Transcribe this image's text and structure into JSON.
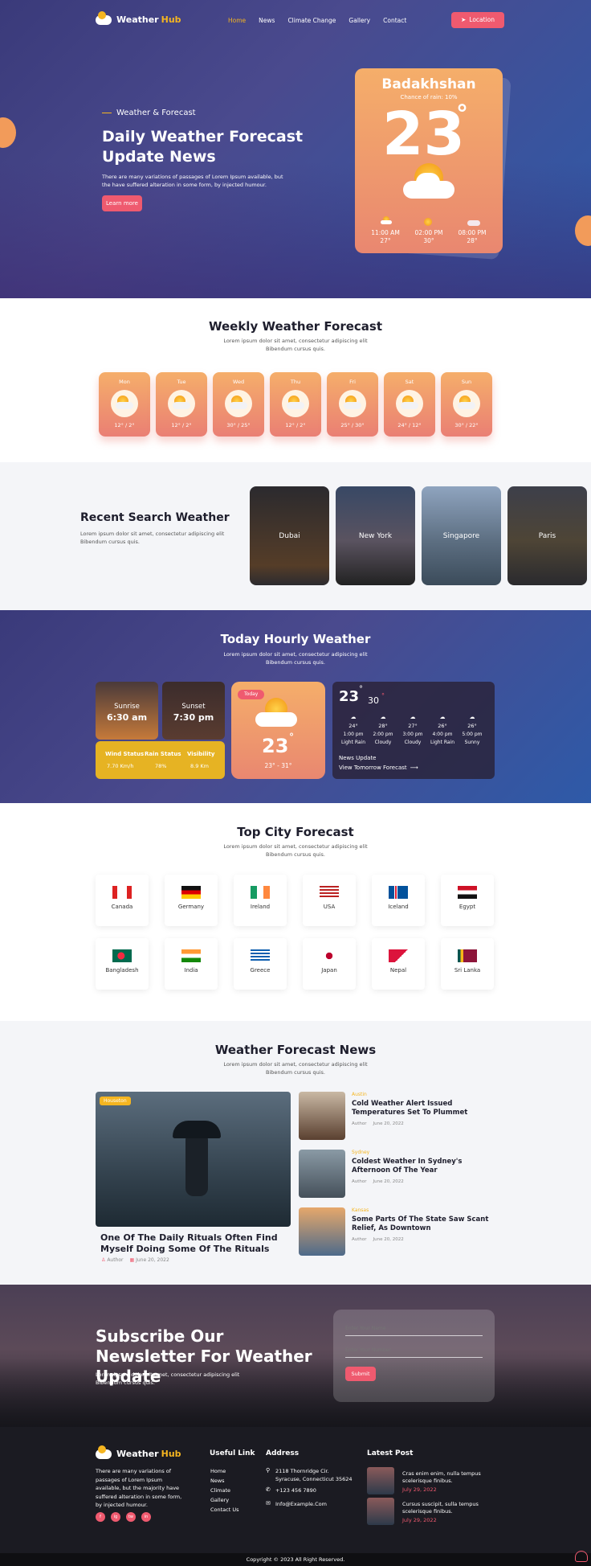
{
  "header": {
    "logo_main": "Weather",
    "logo_accent": "Hub",
    "nav": [
      "Home",
      "News",
      "Climate Change",
      "Gallery",
      "Contact"
    ],
    "location_btn": "Location"
  },
  "hero": {
    "eyebrow": "Weather & Forecast",
    "title": "Daily Weather Forecast Update News",
    "desc": "There are many variations of passages of Lorem Ipsum available, but the have suffered alteration in some form, by injected humour.",
    "cta": "Learn more",
    "card": {
      "city": "Badakhshan",
      "sub": "Chance of rain: 10%",
      "temp": "23",
      "deg": "°",
      "hours": [
        {
          "t": "11:00 AM",
          "v": "27°"
        },
        {
          "t": "02:00 PM",
          "v": "30°"
        },
        {
          "t": "08:00 PM",
          "v": "28°"
        }
      ]
    }
  },
  "weekly": {
    "title": "Weekly Weather Forecast",
    "sub": "Lorem ipsum dolor sit amet, consectetur adipiscing elit Bibendum cursus quis.",
    "days": [
      {
        "d": "Mon",
        "t": "12° / 2°"
      },
      {
        "d": "Tue",
        "t": "12° / 2°"
      },
      {
        "d": "Wed",
        "t": "30° / 25°"
      },
      {
        "d": "Thu",
        "t": "12° / 2°"
      },
      {
        "d": "Fri",
        "t": "25° / 30°"
      },
      {
        "d": "Sat",
        "t": "24° / 12°"
      },
      {
        "d": "Sun",
        "t": "30° / 22°"
      }
    ]
  },
  "recent": {
    "title": "Recent Search Weather",
    "sub": "Lorem ipsum dolor sit amet, consectetur adipiscing elit Bibendum cursus quis.",
    "cities": [
      "Dubai",
      "New York",
      "Singapore",
      "Paris"
    ]
  },
  "hourly": {
    "title": "Today Hourly Weather",
    "sub": "Lorem ipsum dolor sit amet, consectetur adipiscing elit Bibendum cursus quis.",
    "sunrise_label": "Sunrise",
    "sunrise": "6:30 am",
    "sunset_label": "Sunset",
    "sunset": "7:30 pm",
    "stats": [
      {
        "l": "Wind Status",
        "v": "7.70 Km/h"
      },
      {
        "l": "Rain Status",
        "v": "78%"
      },
      {
        "l": "Visibility",
        "v": "8.9 Km"
      }
    ],
    "today_badge": "Today",
    "today_temp": "23",
    "today_range": "23° - 31°",
    "big_temp": "23",
    "small_temp": "30",
    "slots": [
      {
        "deg": "24°",
        "time": "1:00 pm",
        "cond": "Light Rain"
      },
      {
        "deg": "28°",
        "time": "2:00 pm",
        "cond": "Cloudy"
      },
      {
        "deg": "27°",
        "time": "3:00 pm",
        "cond": "Cloudy"
      },
      {
        "deg": "26°",
        "time": "4:00 pm",
        "cond": "Light Rain"
      },
      {
        "deg": "26°",
        "time": "5:00 pm",
        "cond": "Sunny"
      }
    ],
    "news_update": "News Update",
    "tomorrow": "View Tomorrow Forecast"
  },
  "top": {
    "title": "Top City Forecast",
    "sub": "Lorem ipsum dolor sit amet, consectetur adipiscing elit Bibendum cursus quis.",
    "countries": [
      "Canada",
      "Germany",
      "Ireland",
      "USA",
      "Iceland",
      "Egypt",
      "Bangladesh",
      "India",
      "Greece",
      "Japan",
      "Nepal",
      "Sri Lanka"
    ]
  },
  "news": {
    "title": "Weather Forecast News",
    "sub": "Lorem ipsum dolor sit amet, consectetur adipiscing elit Bibendum cursus quis.",
    "main": {
      "tag": "Houseton",
      "title": "One Of The Daily Rituals Often Find Myself Doing Some Of The Rituals",
      "author": "Author",
      "date": "June 20, 2022"
    },
    "items": [
      {
        "tag": "Austin",
        "title": "Cold Weather Alert Issued Temperatures Set To Plummet",
        "author": "Author",
        "date": "June 20, 2022"
      },
      {
        "tag": "Sydney",
        "title": "Coldest Weather In Sydney's Afternoon Of The Year",
        "author": "Author",
        "date": "June 20, 2022"
      },
      {
        "tag": "Kansas",
        "title": "Some Parts Of The State Saw Scant Relief, As Downtown",
        "author": "Author",
        "date": "June 20, 2022"
      }
    ]
  },
  "newsletter": {
    "title": "Subscribe Our Newsletter For Weather Update",
    "sub": "Lorem ipsum dolor sit amet, consectetur adipiscing elit Bibendum cursus quis.",
    "name_ph": "Enter Your Name",
    "number_ph": "Enter Your Number",
    "submit": "Submit"
  },
  "footer": {
    "logo_main": "Weather",
    "logo_accent": "Hub",
    "about": "There are many variations of passages of Lorem Ipsum available, but the majority have suffered alteration in some form, by injected humour.",
    "links_title": "Useful Link",
    "links": [
      "Home",
      "News",
      "Climate",
      "Gallery",
      "Contact Us"
    ],
    "address_title": "Address",
    "address": "2118 Thornridge Cir. Syracuse, Connecticut 35624",
    "phone": "+123 456 7890",
    "email": "Info@Example.Com",
    "latest_title": "Latest Post",
    "posts": [
      {
        "t": "Cras enim enim, nulla tempus scelerisque finibus.",
        "d": "July 29, 2022"
      },
      {
        "t": "Cursus suscipit, sulla tempus scelerisque finibus.",
        "d": "July 29, 2022"
      }
    ],
    "social": [
      "f",
      "ig",
      "tw",
      "in"
    ],
    "copyright": "Copyright © 2023 All Right Reserved."
  },
  "colors": {
    "accent": "#ef5a6f",
    "gold": "#f5b520",
    "navy": "#3a3a7a"
  }
}
